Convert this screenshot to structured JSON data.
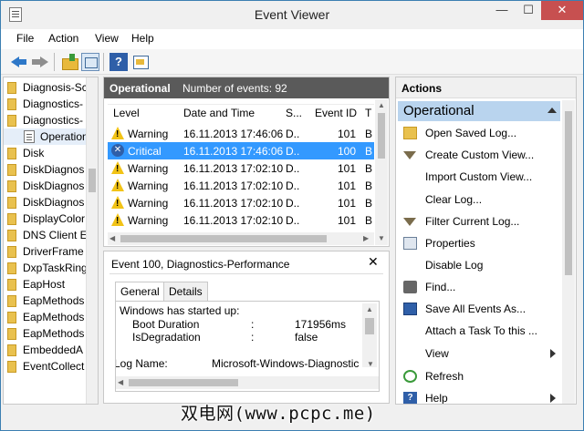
{
  "window": {
    "title": "Event Viewer",
    "min": "—",
    "max": "☐",
    "close": "✕"
  },
  "menu": [
    "File",
    "Action",
    "View",
    "Help"
  ],
  "toolbar": {
    "help_glyph": "?"
  },
  "tree": {
    "items": [
      "Diagnosis-Sc",
      "Diagnostics-",
      "Diagnostics-",
      "Operation",
      "Disk",
      "DiskDiagnos",
      "DiskDiagnos",
      "DiskDiagnos",
      "DisplayColor",
      "DNS Client E",
      "DriverFrame",
      "DxpTaskRing",
      "EapHost",
      "EapMethods",
      "EapMethods",
      "EapMethods",
      "EmbeddedA",
      "EventCollect"
    ]
  },
  "events": {
    "header_name": "Operational",
    "header_count": "Number of events: 92",
    "columns": [
      "Level",
      "Date and Time",
      "S...",
      "Event ID",
      "T"
    ],
    "rows": [
      {
        "level": "Warning",
        "date": "16.11.2013 17:46:06",
        "source": "D..",
        "id": "101",
        "task": "B",
        "icon": "warning-icon"
      },
      {
        "level": "Critical",
        "date": "16.11.2013 17:46:06",
        "source": "D..",
        "id": "100",
        "task": "B",
        "icon": "critical-icon"
      },
      {
        "level": "Warning",
        "date": "16.11.2013 17:02:10",
        "source": "D..",
        "id": "101",
        "task": "B",
        "icon": "warning-icon"
      },
      {
        "level": "Warning",
        "date": "16.11.2013 17:02:10",
        "source": "D..",
        "id": "101",
        "task": "B",
        "icon": "warning-icon"
      },
      {
        "level": "Warning",
        "date": "16.11.2013 17:02:10",
        "source": "D..",
        "id": "101",
        "task": "B",
        "icon": "warning-icon"
      },
      {
        "level": "Warning",
        "date": "16.11.2013 17:02:10",
        "source": "D..",
        "id": "101",
        "task": "B",
        "icon": "warning-icon"
      }
    ]
  },
  "details": {
    "title": "Event 100, Diagnostics-Performance",
    "close": "✕",
    "tabs": [
      "General",
      "Details"
    ],
    "intro": "Windows has started up:",
    "field1_label": "Boot Duration",
    "field1_sep": ":",
    "field1_value": "171956ms",
    "field2_label": "IsDegradation",
    "field2_sep": ":",
    "field2_value": "false",
    "log_label": "Log Name:",
    "log_value": "Microsoft-Windows-Diagnostic"
  },
  "actions": {
    "header": "Actions",
    "section": "Operational",
    "items": [
      {
        "label": "Open Saved Log...",
        "icon": "open-log-icon"
      },
      {
        "label": "Create Custom View...",
        "icon": "filter-icon"
      },
      {
        "label": "Import Custom View...",
        "icon": ""
      },
      {
        "label": "Clear Log...",
        "icon": ""
      },
      {
        "label": "Filter Current Log...",
        "icon": "filter-icon"
      },
      {
        "label": "Properties",
        "icon": "properties-icon"
      },
      {
        "label": "Disable Log",
        "icon": ""
      },
      {
        "label": "Find...",
        "icon": "find-icon"
      },
      {
        "label": "Save All Events As...",
        "icon": "save-icon"
      },
      {
        "label": "Attach a Task To this ...",
        "icon": ""
      },
      {
        "label": "View",
        "icon": ""
      },
      {
        "label": "Refresh",
        "icon": "refresh-icon"
      },
      {
        "label": "Help",
        "icon": "help-icon"
      }
    ]
  },
  "watermark": "双电网(www.pcpc.me)"
}
